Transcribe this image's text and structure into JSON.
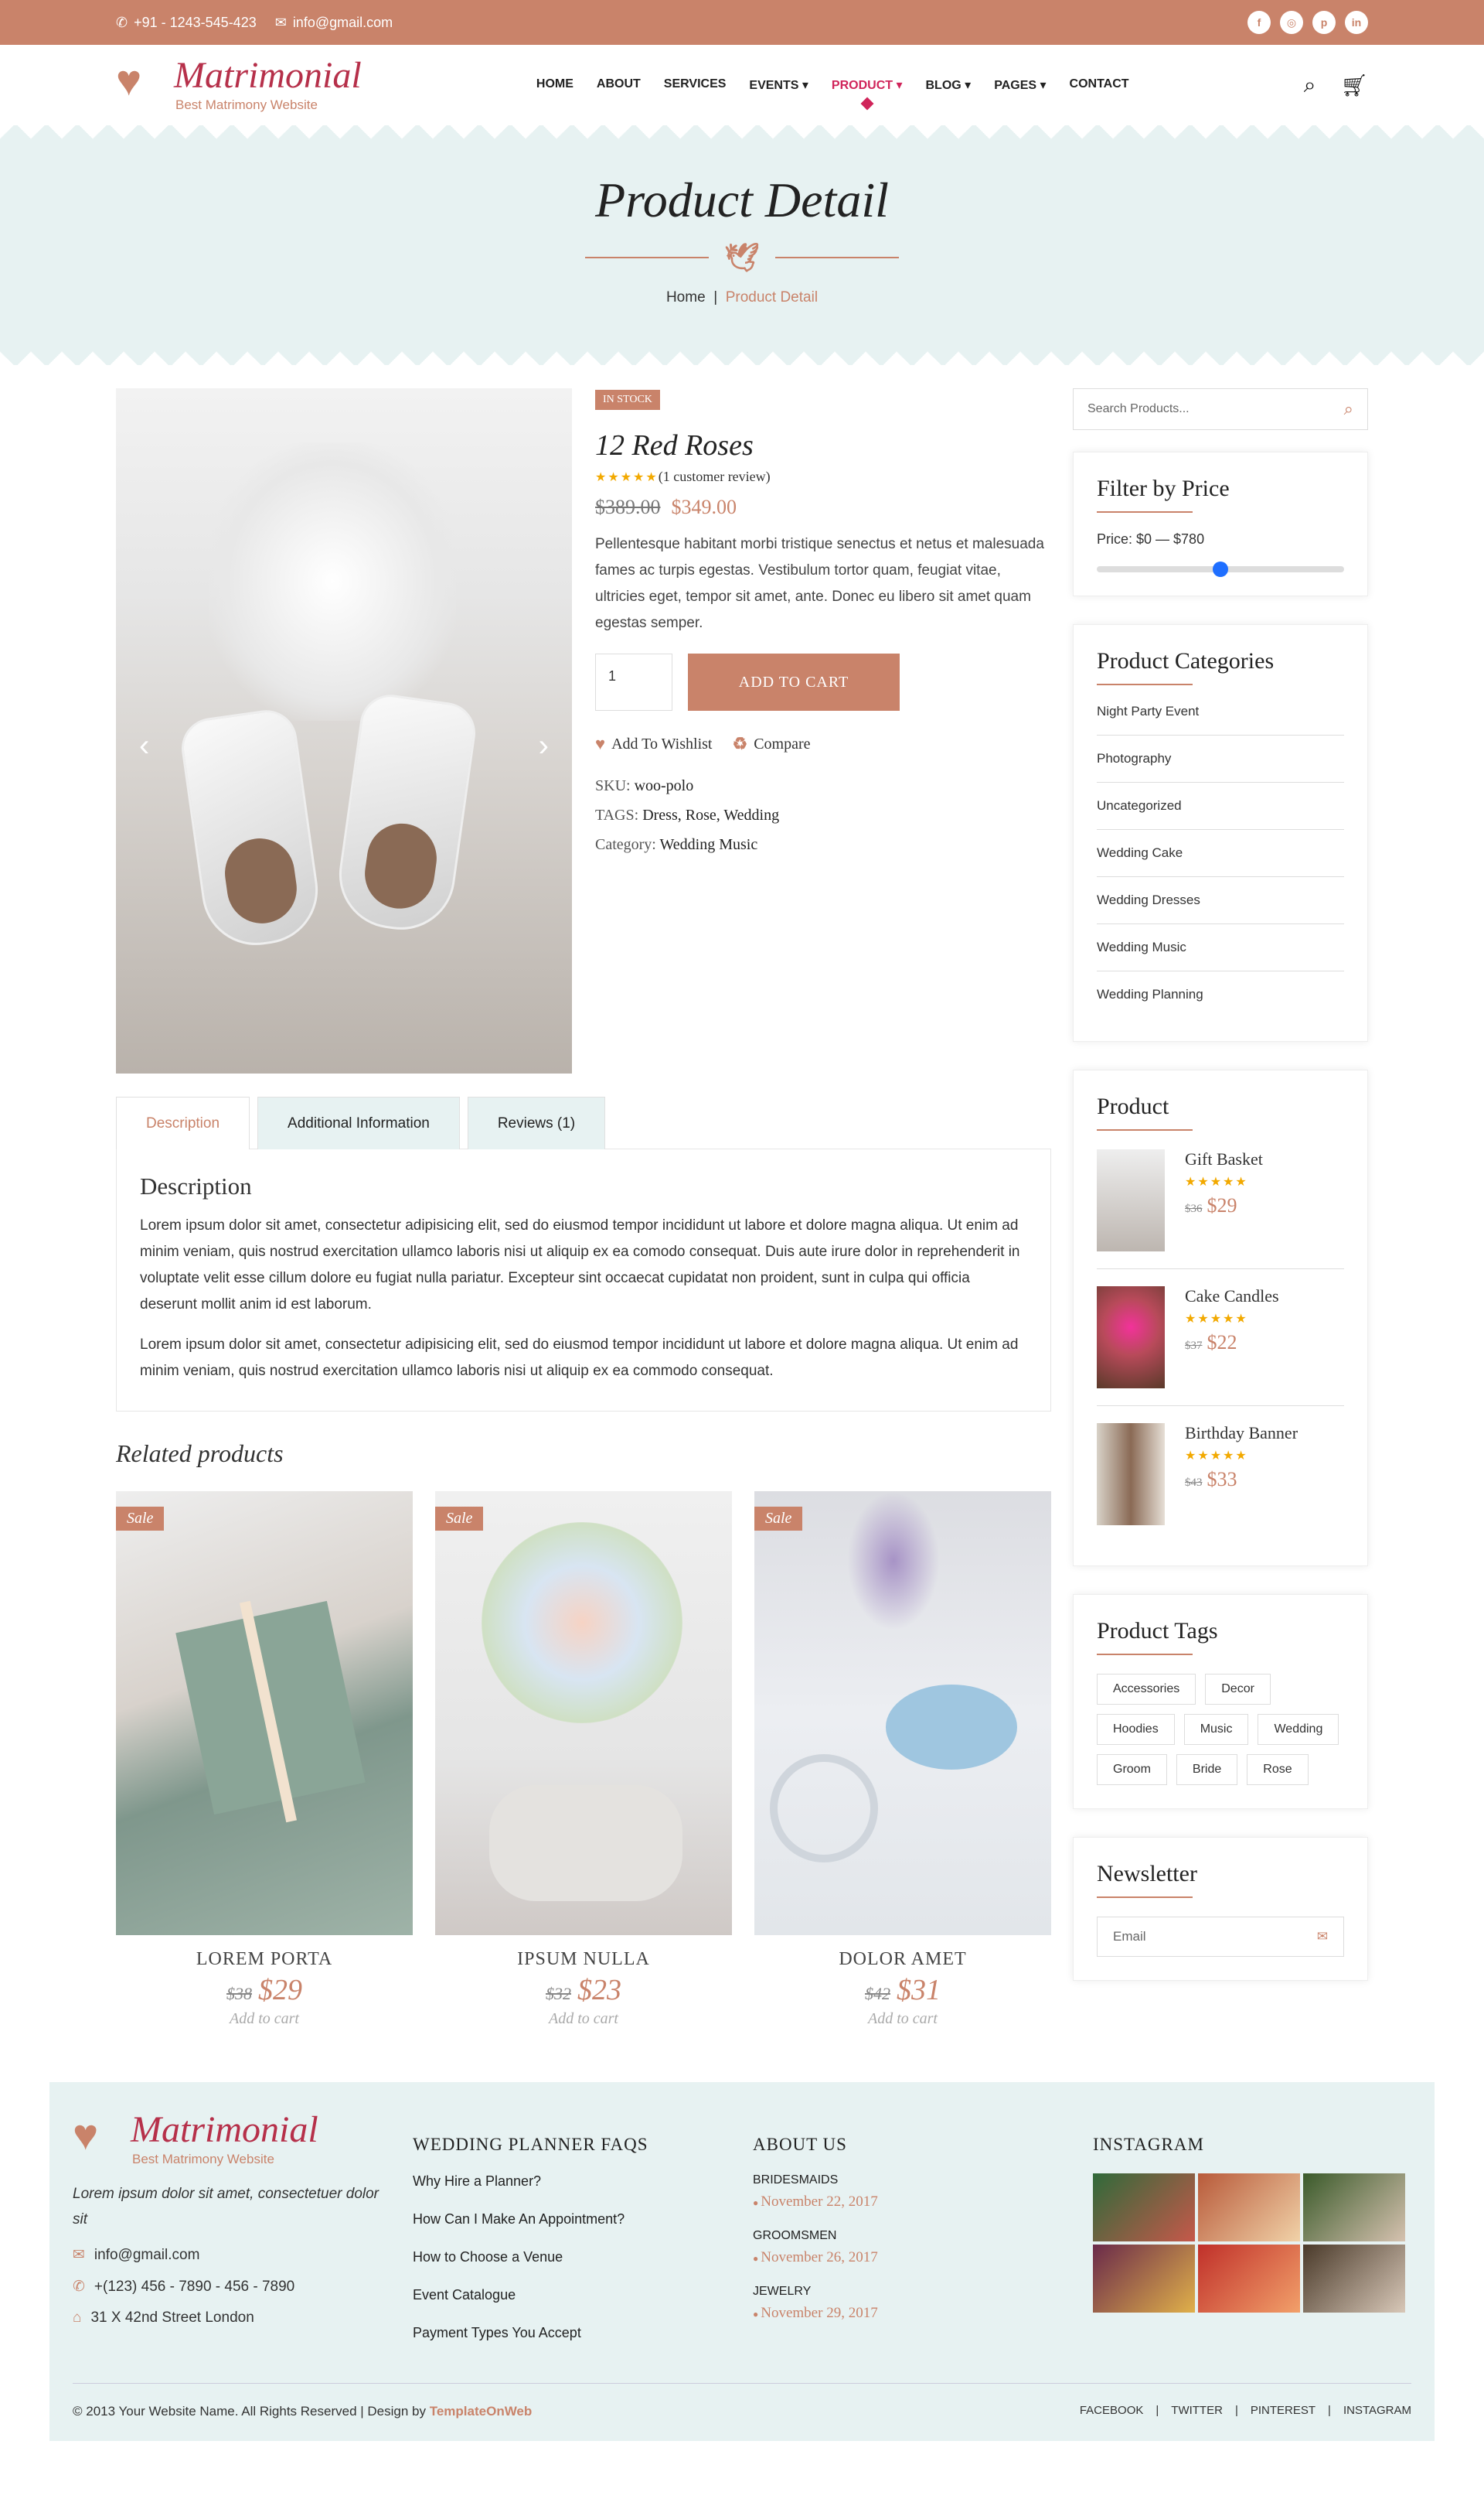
{
  "topbar": {
    "phone": "+91 - 1243-545-423",
    "email": "info@gmail.com",
    "social": [
      "facebook-icon",
      "instagram-icon",
      "pinterest-icon",
      "linkedin-icon"
    ]
  },
  "nav": {
    "logo": "Matrimonial",
    "logo_tag": "Best Matrimony Website",
    "items": [
      "HOME",
      "ABOUT",
      "SERVICES",
      "EVENTS ▾",
      "PRODUCT ▾",
      "BLOG ▾",
      "PAGES ▾",
      "CONTACT"
    ],
    "active_index": 4
  },
  "hero": {
    "title": "Product Detail",
    "crumb_home": "Home",
    "crumb_sep": "|",
    "crumb_current": "Product Detail"
  },
  "product": {
    "badge": "IN STOCK",
    "title": "12 Red Roses",
    "stars": "★★★★★",
    "review": "(1 customer review)",
    "old_price": "$389.00",
    "price": "$349.00",
    "description": "Pellentesque habitant morbi tristique senectus et netus et malesuada fames ac turpis egestas. Vestibulum tortor quam, feugiat vitae, ultricies eget, tempor sit amet, ante. Donec eu libero sit amet quam egestas semper.",
    "qty": "1",
    "add_to_cart": "ADD TO CART",
    "wishlist": "Add To Wishlist",
    "compare": "Compare",
    "sku_label": "SKU:",
    "sku": "woo-polo",
    "tags_label": "TAGS:",
    "tags": "Dress, Rose, Wedding",
    "cat_label": "Category:",
    "category": "Wedding Music"
  },
  "tabs": [
    {
      "label": "Description"
    },
    {
      "label": "Additional Information"
    },
    {
      "label": "Reviews (1)"
    }
  ],
  "tab_panel": {
    "title": "Description",
    "p1": "Lorem ipsum dolor sit amet, consectetur adipisicing elit, sed do eiusmod tempor incididunt ut labore et dolore magna aliqua. Ut enim ad minim veniam, quis nostrud exercitation ullamco laboris nisi ut aliquip ex ea comodo consequat. Duis aute irure dolor in reprehenderit in voluptate velit esse cillum dolore eu fugiat nulla pariatur. Excepteur sint occaecat cupidatat non proident, sunt in culpa qui officia deserunt mollit anim id est laborum.",
    "p2": "Lorem ipsum dolor sit amet, consectetur adipisicing elit, sed do eiusmod tempor incididunt ut labore et dolore magna aliqua. Ut enim ad minim veniam, quis nostrud exercitation ullamco laboris nisi ut aliquip ex ea commodo consequat."
  },
  "related": {
    "title": "Related products",
    "items": [
      {
        "sale": "Sale",
        "name": "LOREM PORTA",
        "old": "$38",
        "price": "$29",
        "add": "Add to cart"
      },
      {
        "sale": "Sale",
        "name": "IPSUM NULLA",
        "old": "$32",
        "price": "$23",
        "add": "Add to cart"
      },
      {
        "sale": "Sale",
        "name": "DOLOR AMET",
        "old": "$42",
        "price": "$31",
        "add": "Add to cart"
      }
    ]
  },
  "sidebar": {
    "search_placeholder": "Search Products...",
    "filter_title": "Filter by Price",
    "price_range": "Price: $0 — $780",
    "categories_title": "Product Categories",
    "categories": [
      "Night Party Event",
      "Photography",
      "Uncategorized",
      "Wedding Cake",
      "Wedding Dresses",
      "Wedding Music",
      "Wedding Planning"
    ],
    "product_title": "Product",
    "products": [
      {
        "name": "Gift Basket",
        "stars": "★★★★★",
        "old": "$36",
        "price": "$29"
      },
      {
        "name": "Cake Candles",
        "stars": "★★★★★",
        "old": "$37",
        "price": "$22"
      },
      {
        "name": "Birthday Banner",
        "stars": "★★★★★",
        "old": "$43",
        "price": "$33"
      }
    ],
    "tags_title": "Product Tags",
    "tags": [
      "Accessories",
      "Decor",
      "Hoodies",
      "Music",
      "Wedding",
      "Groom",
      "Bride",
      "Rose"
    ],
    "newsletter_title": "Newsletter",
    "newsletter_placeholder": "Email"
  },
  "footer": {
    "logo": "Matrimonial",
    "logo_tag": "Best Matrimony Website",
    "blurb": "Lorem ipsum dolor sit amet, consectetuer dolor sit",
    "email": "info@gmail.com",
    "phone": "+(123) 456 - 7890 - 456 - 7890",
    "address": "31 X 42nd Street London",
    "faq_title": "WEDDING PLANNER FAQS",
    "faq": [
      "Why Hire a Planner?",
      "How Can I Make An Appointment?",
      "How to Choose a Venue",
      "Event Catalogue",
      "Payment Types You Accept"
    ],
    "about_title": "ABOUT US",
    "about": [
      {
        "t": "BRIDESMAIDS",
        "d": "November 22, 2017"
      },
      {
        "t": "GROOMSMEN",
        "d": "November 26, 2017"
      },
      {
        "t": "JEWELRY",
        "d": "November 29, 2017"
      }
    ],
    "insta_title": "INSTAGRAM",
    "copyright": "© 2013 Your Website Name. All Rights Reserved | Design by",
    "brand": "TemplateOnWeb",
    "links": [
      "FACEBOOK",
      "|",
      "TWITTER",
      "|",
      "PINTEREST",
      "|",
      "INSTAGRAM"
    ]
  }
}
